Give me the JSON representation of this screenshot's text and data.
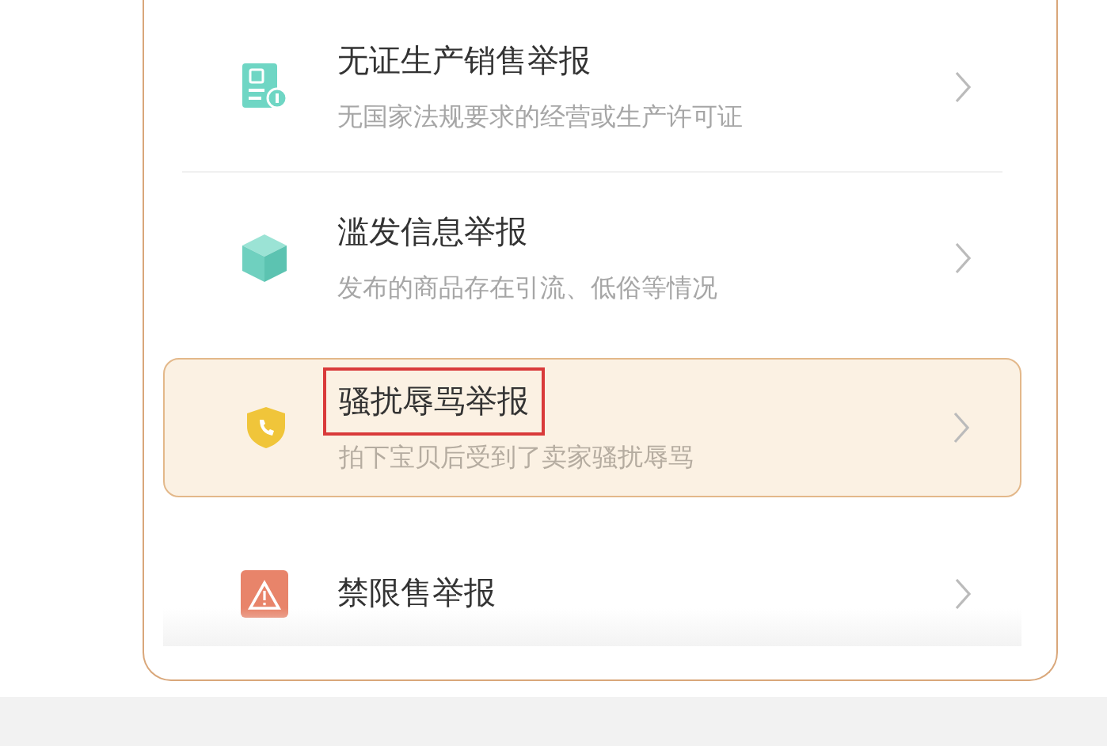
{
  "report_items": [
    {
      "kind": "license",
      "title": "无证生产销售举报",
      "subtitle": "无国家法规要求的经营或生产许可证",
      "selected": false,
      "annotated": false
    },
    {
      "kind": "cube",
      "title": "滥发信息举报",
      "subtitle": "发布的商品存在引流、低俗等情况",
      "selected": false,
      "annotated": false
    },
    {
      "kind": "shield",
      "title": "骚扰辱骂举报",
      "subtitle": "拍下宝贝后受到了卖家骚扰辱骂",
      "selected": true,
      "annotated": true
    },
    {
      "kind": "warning",
      "title": "禁限售举报",
      "selected": false,
      "annotated": false
    }
  ]
}
